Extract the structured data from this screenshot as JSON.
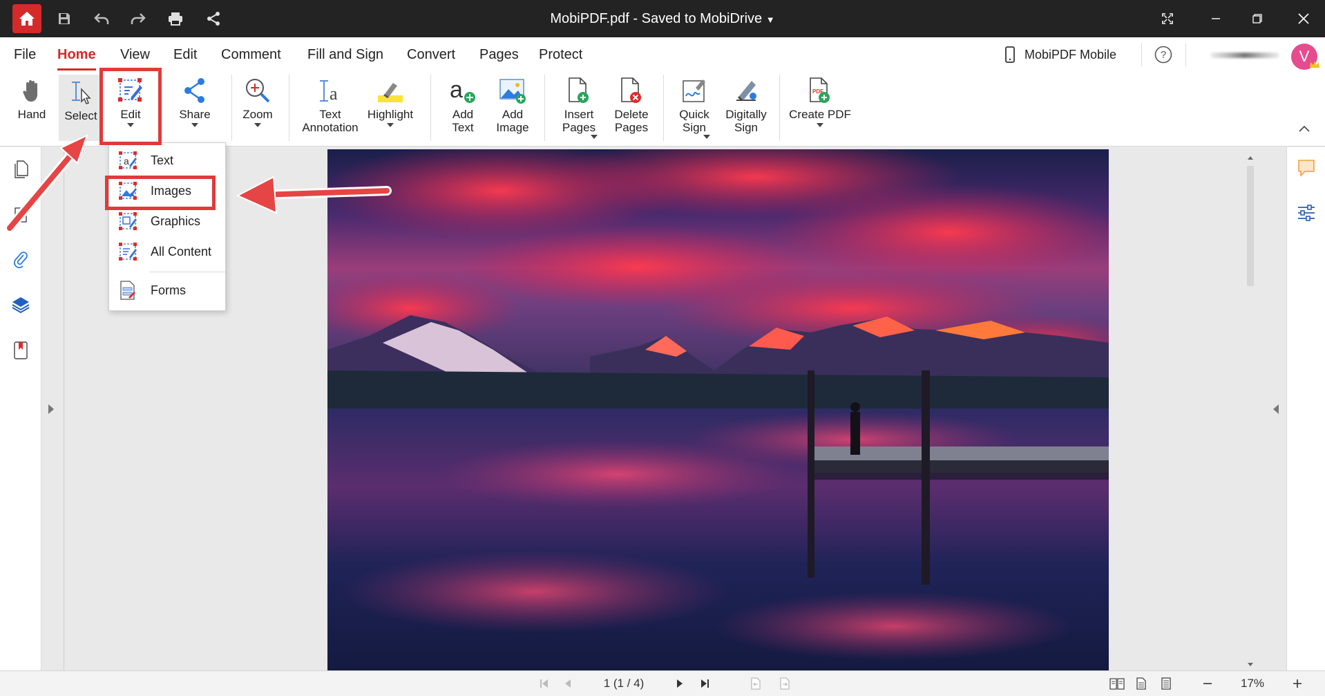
{
  "titlebar": {
    "title": "MobiPDF.pdf - Saved to MobiDrive",
    "icons": [
      "home-icon",
      "save-icon",
      "undo-icon",
      "redo-icon",
      "print-icon",
      "share-icon"
    ]
  },
  "tabs": [
    "File",
    "Home",
    "View",
    "Edit",
    "Comment",
    "Fill and Sign",
    "Convert",
    "Pages",
    "Protect"
  ],
  "active_tab": "Home",
  "mobile_label": "MobiPDF Mobile",
  "avatar_initial": "V",
  "ribbon": {
    "hand": "Hand",
    "select": "Select",
    "edit": "Edit",
    "share": "Share",
    "zoom": "Zoom",
    "text_annotation": "Text\nAnnotation",
    "highlight": "Highlight",
    "add_text": "Add\nText",
    "add_image": "Add\nImage",
    "insert_pages": "Insert\nPages",
    "delete_pages": "Delete\nPages",
    "quick_sign": "Quick\nSign",
    "digitally_sign": "Digitally\nSign",
    "create_pdf": "Create PDF"
  },
  "edit_menu": {
    "items": [
      "Text",
      "Images",
      "Graphics",
      "All Content",
      "Forms"
    ],
    "highlighted": "Images"
  },
  "statusbar": {
    "page_indicator": "1 (1 / 4)",
    "zoom_level": "17%"
  },
  "colors": {
    "accent": "#d42a2a",
    "titlebar": "#232323",
    "annotation": "#e03a3a"
  }
}
